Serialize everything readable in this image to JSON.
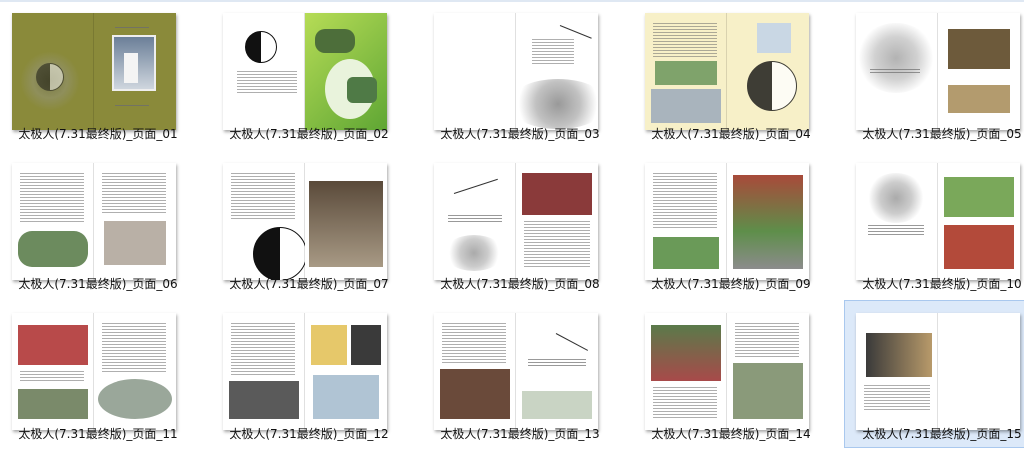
{
  "window": {
    "tiles": [
      {
        "caption": "太极人(7.31最终版)_页面_01",
        "selected": false
      },
      {
        "caption": "太极人(7.31最终版)_页面_02",
        "selected": false
      },
      {
        "caption": "太极人(7.31最终版)_页面_03",
        "selected": false
      },
      {
        "caption": "太极人(7.31最终版)_页面_04",
        "selected": false
      },
      {
        "caption": "太极人(7.31最终版)_页面_05",
        "selected": false
      },
      {
        "caption": "太极人(7.31最终版)_页面_06",
        "selected": false
      },
      {
        "caption": "太极人(7.31最终版)_页面_07",
        "selected": false
      },
      {
        "caption": "太极人(7.31最终版)_页面_08",
        "selected": false
      },
      {
        "caption": "太极人(7.31最终版)_页面_09",
        "selected": false
      },
      {
        "caption": "太极人(7.31最终版)_页面_10",
        "selected": false
      },
      {
        "caption": "太极人(7.31最终版)_页面_11",
        "selected": false
      },
      {
        "caption": "太极人(7.31最终版)_页面_12",
        "selected": false
      },
      {
        "caption": "太极人(7.31最终版)_页面_13",
        "selected": false
      },
      {
        "caption": "太极人(7.31最终版)_页面_14",
        "selected": false
      },
      {
        "caption": "太极人(7.31最终版)_页面_15",
        "selected": true
      }
    ]
  },
  "colors": {
    "selection_fill": "#dce9f9",
    "selection_border": "#a9c8ee",
    "cover_olive": "#8a8a3a",
    "green_spread": "#8cc63f",
    "cream_spread": "#f7f0c8"
  }
}
